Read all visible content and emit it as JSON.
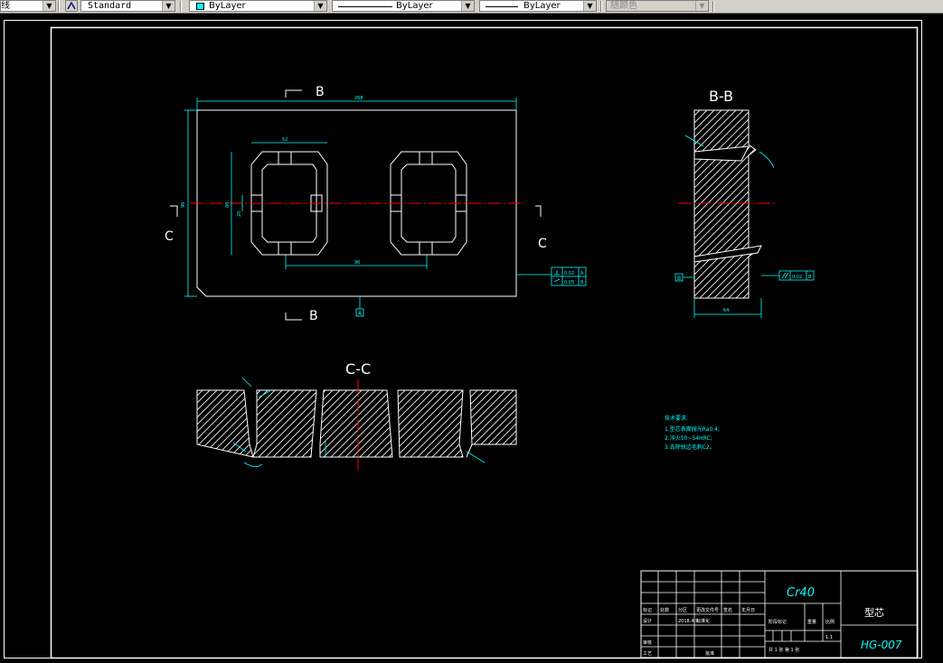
{
  "toolbar": {
    "layer_label": "线",
    "text_style": "Standard",
    "color": "ByLayer",
    "color_swatch": "#00ffff",
    "linetype": "ByLayer",
    "lineweight": "ByLayer",
    "plot_style": "随颜色"
  },
  "drawing": {
    "main_view": {
      "section_mark_top": "B",
      "section_mark_bottom": "B",
      "section_mark_left": "C",
      "section_mark_right": "C",
      "dim_width": "268",
      "dim_height": "96",
      "dim_slot_width": "52",
      "dim_pitch": "96",
      "dim_inner": "80",
      "dim_small": "20",
      "datum_a": "A",
      "tol_perp_value": "0.02",
      "tol_perp_datum": "A",
      "tol_flat_value": "0.05",
      "tol_flat_datum": "B"
    },
    "section_bb": {
      "title": "B-B",
      "dim_bottom": "64",
      "datum_b": "B",
      "tol_parallel_value": "0.02",
      "tol_parallel_datum": "B"
    },
    "section_cc": {
      "title": "C-C"
    },
    "tech_notes": {
      "heading": "技术要求:",
      "lines": [
        "1.型芯表面抛光Ra0.4;",
        "2.淬火50~54HRC;",
        "3.去除锐边毛刺C2。"
      ]
    },
    "title_block": {
      "material": "Cr40",
      "part_name": "型芯",
      "drawing_no": "HG-007",
      "scale": "1:1",
      "row_headers": [
        "标记",
        "处数",
        "分区",
        "更改文件号",
        "签名",
        "年月日"
      ],
      "designer_label": "设计",
      "checker_label": "审核",
      "process_label": "工艺",
      "approve_label": "批准",
      "standard_label": "标准化",
      "date": "2018.4.9",
      "stage_label": "阶段标记",
      "weight_label": "重量",
      "scale_label": "比例",
      "sheet_label": "共 1 张  第 1 张"
    }
  }
}
